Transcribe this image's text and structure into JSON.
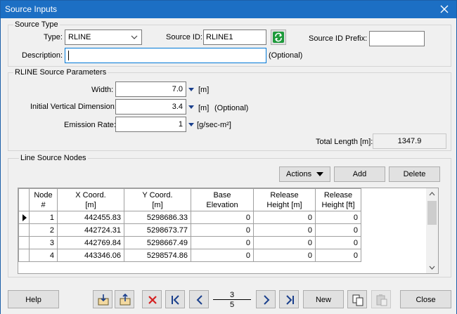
{
  "window": {
    "title": "Source Inputs"
  },
  "source_type": {
    "legend": "Source Type",
    "type_label": "Type:",
    "type_value": "RLINE",
    "source_id_label": "Source ID:",
    "source_id_value": "RLINE1",
    "prefix_label": "Source ID Prefix:",
    "prefix_value": "",
    "description_label": "Description:",
    "description_value": "",
    "optional": "(Optional)"
  },
  "params": {
    "legend": "RLINE Source Parameters",
    "width_label": "Width:",
    "width_value": "7.0",
    "width_unit": "[m]",
    "ivd_label": "Initial Vertical Dimension:",
    "ivd_value": "3.4",
    "ivd_unit": "[m]",
    "ivd_optional": "(Optional)",
    "emission_label": "Emission Rate:",
    "emission_value": "1",
    "emission_unit": "[g/sec-m²]",
    "total_length_label": "Total Length [m]:",
    "total_length_value": "1347.9"
  },
  "nodes": {
    "legend": "Line Source Nodes",
    "actions_label": "Actions",
    "add_label": "Add",
    "delete_label": "Delete",
    "columns": [
      [
        "Node",
        "#"
      ],
      [
        "X Coord.",
        "[m]"
      ],
      [
        "Y Coord.",
        "[m]"
      ],
      [
        "Base",
        "Elevation"
      ],
      [
        "Release",
        "Height [m]"
      ],
      [
        "Release",
        "Height [ft]"
      ]
    ],
    "rows": [
      [
        "1",
        "442455.83",
        "5298686.33",
        "0",
        "0",
        "0"
      ],
      [
        "2",
        "442724.31",
        "5298673.77",
        "0",
        "0",
        "0"
      ],
      [
        "3",
        "442769.84",
        "5298667.49",
        "0",
        "0",
        "0"
      ],
      [
        "4",
        "443346.06",
        "5298574.86",
        "0",
        "0",
        "0"
      ]
    ]
  },
  "footer": {
    "help_label": "Help",
    "record_current": "3",
    "record_total": "5",
    "new_label": "New",
    "close_label": "Close"
  },
  "colors": {
    "titlebar": "#1c6fc4",
    "arrow": "#1a3f8c",
    "focus": "#0078d7"
  }
}
